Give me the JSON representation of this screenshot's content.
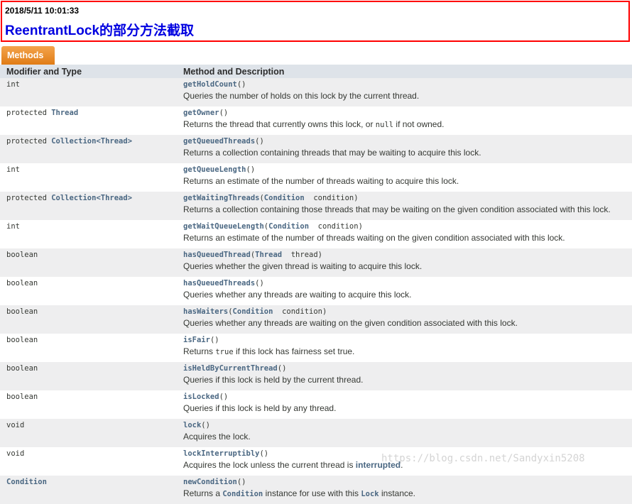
{
  "header": {
    "timestamp": "2018/5/11 10:01:33",
    "title": "ReentrantLock的部分方法截取"
  },
  "tab": {
    "label": "Methods"
  },
  "columns": {
    "type": "Modifier and Type",
    "method": "Method and Description"
  },
  "rows": [
    {
      "type": "int",
      "name": "getHoldCount",
      "sig": "()",
      "desc": "Queries the number of holds on this lock by the current thread."
    },
    {
      "type_prefix": "protected ",
      "type_link": "Thread",
      "name": "getOwner",
      "sig": "()",
      "desc_a": "Returns the thread that currently owns this lock, or ",
      "desc_code": "null",
      "desc_b": " if not owned."
    },
    {
      "type_prefix": "protected ",
      "type_link": "Collection",
      "type_lt": "<",
      "type_link2": "Thread",
      "type_gt": ">",
      "name": "getQueuedThreads",
      "sig": "()",
      "desc": "Returns a collection containing threads that may be waiting to acquire this lock."
    },
    {
      "type": "int",
      "name": "getQueueLength",
      "sig": "()",
      "desc": "Returns an estimate of the number of threads waiting to acquire this lock."
    },
    {
      "type_prefix": "protected ",
      "type_link": "Collection",
      "type_lt": "<",
      "type_link2": "Thread",
      "type_gt": ">",
      "name": "getWaitingThreads",
      "sig_open": "(",
      "param_type": "Condition",
      "param_name": "  condition)",
      "desc": "Returns a collection containing those threads that may be waiting on the given condition associated with this lock."
    },
    {
      "type": "int",
      "name": "getWaitQueueLength",
      "sig_open": "(",
      "param_type": "Condition",
      "param_name": "  condition)",
      "desc": "Returns an estimate of the number of threads waiting on the given condition associated with this lock."
    },
    {
      "type": "boolean",
      "name": "hasQueuedThread",
      "sig_open": "(",
      "param_type": "Thread",
      "param_name": "  thread)",
      "desc": "Queries whether the given thread is waiting to acquire this lock."
    },
    {
      "type": "boolean",
      "name": "hasQueuedThreads",
      "sig": "()",
      "desc": "Queries whether any threads are waiting to acquire this lock."
    },
    {
      "type": "boolean",
      "name": "hasWaiters",
      "sig_open": "(",
      "param_type": "Condition",
      "param_name": "  condition)",
      "desc": "Queries whether any threads are waiting on the given condition associated with this lock."
    },
    {
      "type": "boolean",
      "name": "isFair",
      "sig": "()",
      "desc_a": "Returns ",
      "desc_code": "true",
      "desc_b": " if this lock has fairness set true."
    },
    {
      "type": "boolean",
      "name": "isHeldByCurrentThread",
      "sig": "()",
      "desc": "Queries if this lock is held by the current thread."
    },
    {
      "type": "boolean",
      "name": "isLocked",
      "sig": "()",
      "desc": "Queries if this lock is held by any thread."
    },
    {
      "type": "void",
      "name": "lock",
      "sig": "()",
      "desc": "Acquires the lock."
    },
    {
      "type": "void",
      "name": "lockInterruptibly",
      "sig": "()",
      "desc_a": "Acquires the lock unless the current thread is ",
      "desc_link": "interrupted",
      "desc_b": "."
    },
    {
      "type_link": "Condition",
      "name": "newCondition",
      "sig": "()",
      "desc_a": "Returns a ",
      "desc_code": "Condition",
      "desc_mid": " instance for use with this ",
      "desc_code2": "Lock",
      "desc_b": " instance."
    }
  ],
  "watermark": "https://blog.csdn.net/Sandyxin5208"
}
